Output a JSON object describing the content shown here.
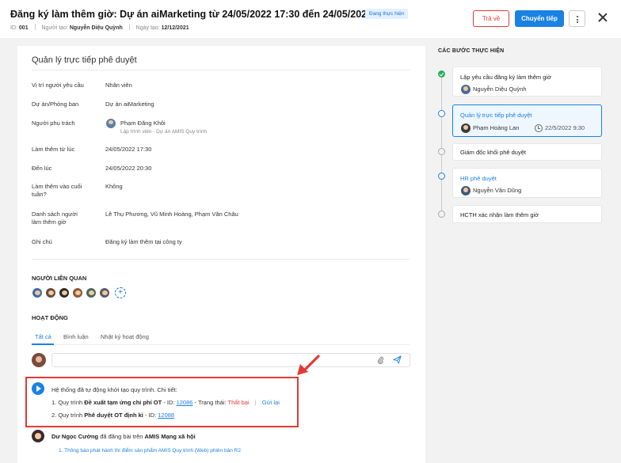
{
  "header": {
    "title": "Đăng ký làm thêm giờ: Dự án aiMarketing từ 24/05/2022 17:30 đến 24/05/2022 20:30",
    "status": "Đang thực hiện",
    "id_label": "ID:",
    "id_value": "001",
    "creator_label": "Người tạo:",
    "creator_value": "Nguyễn Diệu Quỳnh",
    "date_label": "Ngày tạo:",
    "date_value": "12/12/2021",
    "return_button": "Trả về",
    "forward_button": "Chuyển tiếp"
  },
  "form": {
    "title": "Quản lý trực tiếp phê duyệt",
    "rows": [
      {
        "label": "Vị trí người yêu cầu",
        "value": "Nhân viên"
      },
      {
        "label": "Dự án/Phòng ban",
        "value": "Dự án aiMarketing"
      },
      {
        "label": "Người phụ trách",
        "value": "Phạm Đăng Khôi",
        "sub": "Lập trình viên - Dự án AMIS Quy trình"
      },
      {
        "label": "Làm thêm từ lúc",
        "value": "24/05/2022 17:30"
      },
      {
        "label": "Đến lúc",
        "value": "24/05/2022 20:30"
      },
      {
        "label": "Làm thêm vào cuối tuần?",
        "value": "Không"
      },
      {
        "label": "Danh sách người làm thêm giờ",
        "value": "Lê Thụ Phương, Vũ Minh Hoàng, Phạm Văn Châu"
      },
      {
        "label": "Ghi chú",
        "value": "Đăng ký làm thêm tại công ty"
      }
    ]
  },
  "related": {
    "title": "NGƯỜI LIÊN QUAN",
    "add_symbol": "+"
  },
  "activity": {
    "title": "HOẠT ĐỘNG",
    "tabs": [
      "Tất cả",
      "Bình luận",
      "Nhật ký hoạt động"
    ],
    "system_message": "Hệ thống đã tự động khởi tạo quy trình. Chi tiết:",
    "item1_prefix": "1. Quy trình",
    "item1_name": "Đề xuất tạm ứng chi phí OT",
    "item1_id_label": "- ID:",
    "item1_id": "12086",
    "item1_status_label": "- Trạng thái:",
    "item1_status": "Thất bại",
    "item1_separator": "|",
    "item1_retry": "Gửi lại",
    "item2_prefix": "2. Quy trình",
    "item2_name": "Phê duyệt OT định kì",
    "item2_id_label": "- ID:",
    "item2_id": "12088",
    "post_author": "Dư Ngọc Cường",
    "post_text": "đã đăng bài trên",
    "post_target": "AMIS Mạng xã hội",
    "post_link": "1. Thông báo phát hành thí điểm sản phẩm AMIS Quy trình (Web) phiên bản R2"
  },
  "steps": {
    "title": "CÁC BƯỚC THỰC HIỆN",
    "items": [
      {
        "name": "Lập yêu cầu đăng ký làm thêm giờ",
        "person": "Nguyễn Diệu Quỳnh"
      },
      {
        "name": "Quản lý trực tiếp phê duyệt",
        "person": "Phạm Hoàng Lan",
        "time": "22/5/2022 9:30"
      },
      {
        "name": "Giám đốc khối phê duyệt"
      },
      {
        "name": "HR phê duyệt",
        "person": "Nguyễn Văn Dũng"
      },
      {
        "name": "HCTH xác nhận làm thêm giờ"
      }
    ]
  },
  "colors": {
    "accent": "#1a82e2",
    "danger": "#e53935",
    "success": "#27ae60"
  }
}
